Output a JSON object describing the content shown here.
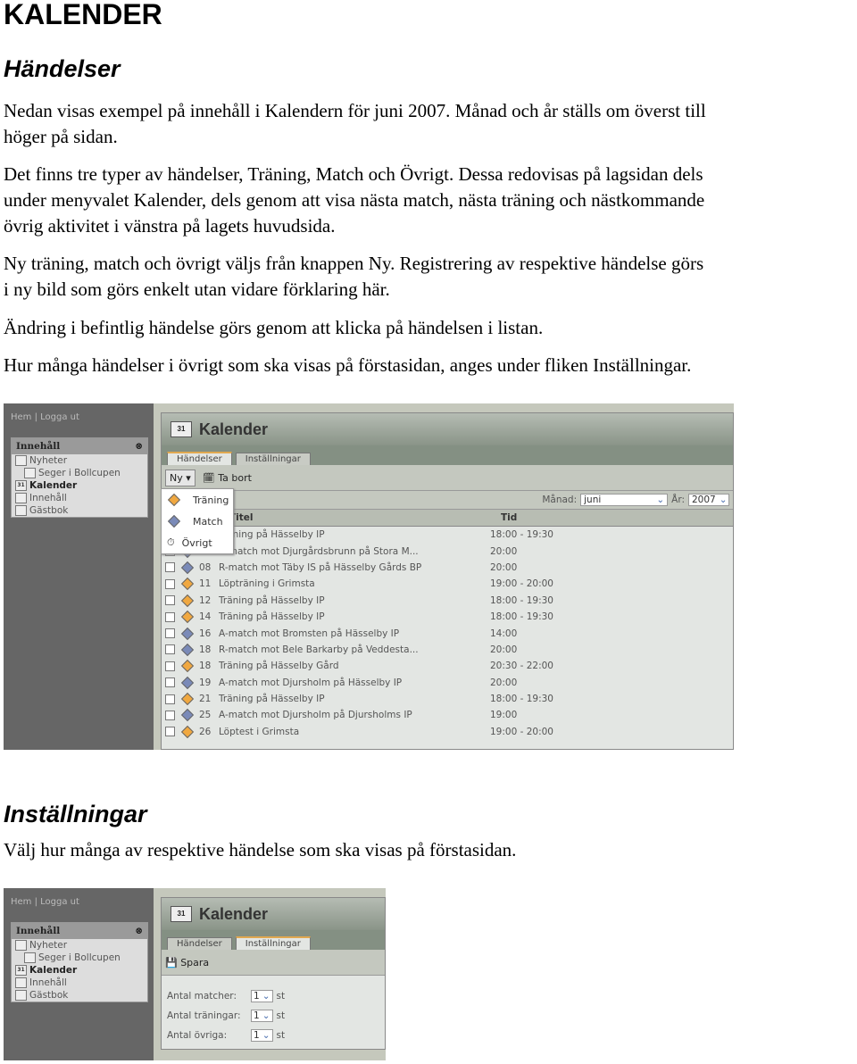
{
  "heading": "KALENDER",
  "section1": {
    "title": "Händelser",
    "paragraphs": [
      "Nedan visas exempel på innehåll i Kalendern för juni 2007. Månad och år ställs om överst till",
      "höger på sidan.",
      "Det finns tre typer av händelser, Träning, Match och Övrigt. Dessa redovisas på lagsidan dels",
      "under menyvalet Kalender, dels genom att visa nästa match, nästa träning och nästkommande",
      "övrig aktivitet i vänstra på lagets huvudsida.",
      "Ny träning, match och övrigt väljs från knappen Ny. Registrering av respektive händelse görs",
      "i ny bild som görs enkelt utan vidare förklaring här.",
      "Ändring i befintlig händelse görs genom att klicka på händelsen i listan.",
      "Hur många händelser i övrigt som ska visas på förstasidan, anges under fliken Inställningar."
    ]
  },
  "section2": {
    "title": "Inställningar",
    "paragraph": "Välj hur många av respektive händelse som ska visas på förstasidan."
  },
  "app": {
    "toplinks": "Hem | Logga ut",
    "box_title": "Innehåll",
    "sidebar": [
      "Nyheter",
      "Seger i Bollcupen",
      "Kalender",
      "Innehåll",
      "Gästbok"
    ],
    "page_title": "Kalender",
    "cal_icon": "31",
    "tabs": [
      "Händelser",
      "Inställningar"
    ],
    "new_button": "Ny ▾",
    "delete_button": "Ta bort",
    "save_button": "Spara",
    "month_label": "Månad:",
    "month_value": "juni",
    "year_label": "År:",
    "year_value": "2007",
    "col_title": "Titel",
    "col_time": "Tid",
    "new_menu": [
      "Träning",
      "Match",
      "Övrigt"
    ],
    "events": [
      {
        "type": "t",
        "date": "",
        "title": "Träning på Hässelby IP",
        "time": "18:00 - 19:30"
      },
      {
        "type": "m",
        "date": "",
        "title": "A-match mot Djurgårdsbrunn på Stora M...",
        "time": "20:00"
      },
      {
        "type": "m",
        "date": "08",
        "title": "R-match mot Täby IS på Hässelby Gårds BP",
        "time": "20:00"
      },
      {
        "type": "t",
        "date": "11",
        "title": "Löpträning i Grimsta",
        "time": "19:00 - 20:00"
      },
      {
        "type": "t",
        "date": "12",
        "title": "Träning på Hässelby IP",
        "time": "18:00 - 19:30"
      },
      {
        "type": "t",
        "date": "14",
        "title": "Träning på Hässelby IP",
        "time": "18:00 - 19:30"
      },
      {
        "type": "m",
        "date": "16",
        "title": "A-match mot Bromsten på Hässelby IP",
        "time": "14:00"
      },
      {
        "type": "m",
        "date": "18",
        "title": "R-match mot Bele Barkarby på Veddesta...",
        "time": "20:00"
      },
      {
        "type": "t",
        "date": "18",
        "title": "Träning på Hässelby Gård",
        "time": "20:30 - 22:00"
      },
      {
        "type": "m",
        "date": "19",
        "title": "A-match mot Djursholm på Hässelby IP",
        "time": "20:00"
      },
      {
        "type": "t",
        "date": "21",
        "title": "Träning på Hässelby IP",
        "time": "18:00 - 19:30"
      },
      {
        "type": "m",
        "date": "25",
        "title": "A-match mot Djursholm på Djursholms IP",
        "time": "19:00"
      },
      {
        "type": "t",
        "date": "26",
        "title": "Löptest i Grimsta",
        "time": "19:00 - 20:00"
      }
    ],
    "settings": [
      {
        "label": "Antal matcher:",
        "value": "1",
        "unit": "st"
      },
      {
        "label": "Antal träningar:",
        "value": "1",
        "unit": "st"
      },
      {
        "label": "Antal övriga:",
        "value": "1",
        "unit": "st"
      }
    ],
    "colors": {
      "training": "#f0a840",
      "match": "#7a8ab8",
      "sidebar": "#666666"
    }
  }
}
